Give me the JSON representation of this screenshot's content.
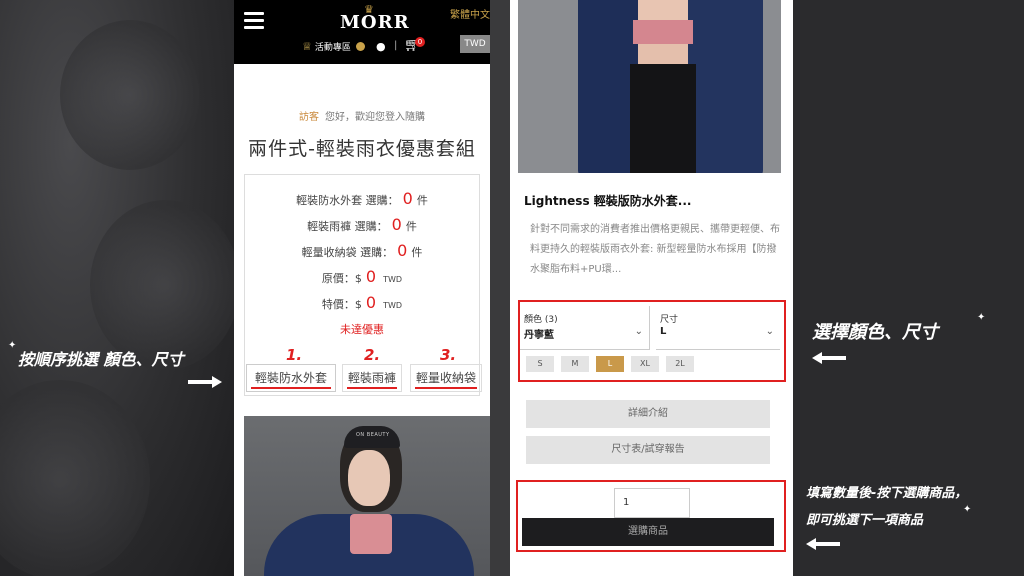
{
  "header": {
    "logo": "MORR",
    "language": "繁體中文",
    "promo_label": "活動專區",
    "cart_count": "0",
    "currency": "TWD"
  },
  "welcome": {
    "guest": "訪客",
    "message": "您好，歡迎您登入隨購"
  },
  "page_title": "兩件式-輕裝雨衣優惠套組",
  "summary": {
    "rows": [
      {
        "label": "輕裝防水外套 選購：",
        "count": "0",
        "unit": "件"
      },
      {
        "label": "輕裝雨褲 選購：",
        "count": "0",
        "unit": "件"
      },
      {
        "label": "輕量收納袋 選購：",
        "count": "0",
        "unit": "件"
      }
    ],
    "original_price": {
      "label": "原價：$",
      "value": "0",
      "currency": "TWD"
    },
    "special_price": {
      "label": "特價：$",
      "value": "0",
      "currency": "TWD"
    },
    "discount_status": "未達優惠"
  },
  "steps": [
    {
      "num": "1.",
      "label": "輕裝防水外套"
    },
    {
      "num": "2.",
      "label": "輕裝雨褲"
    },
    {
      "num": "3.",
      "label": "輕量收納袋"
    }
  ],
  "photo_cap_text": "ON BEAUTY",
  "product": {
    "name": "Lightness 輕裝版防水外套...",
    "description": "針對不同需求的消費者推出價格更親民、攜帶更輕便、布料更持久的輕裝版雨衣外套: 新型輕量防水布採用【防撥水聚脂布料+PU環..."
  },
  "options": {
    "color_label": "顏色",
    "color_count": "(3)",
    "color_value": "丹寧藍",
    "size_label": "尺寸",
    "size_value": "L",
    "sizes": [
      "S",
      "M",
      "L",
      "XL",
      "2L"
    ],
    "selected_size": "L"
  },
  "buttons": {
    "details": "詳細介紹",
    "size_chart": "尺寸表/試穿報告",
    "buy": "選購商品"
  },
  "quantity": "1",
  "annotations": {
    "left": "按順序挑選 顏色、尺寸",
    "right_top": "選擇顏色、尺寸",
    "right_bottom_1": "填寫數量後-按下選購商品，",
    "right_bottom_2": "即可挑選下一項商品"
  },
  "colors": {
    "accent_red": "#e02020",
    "gold": "#c9994a"
  }
}
